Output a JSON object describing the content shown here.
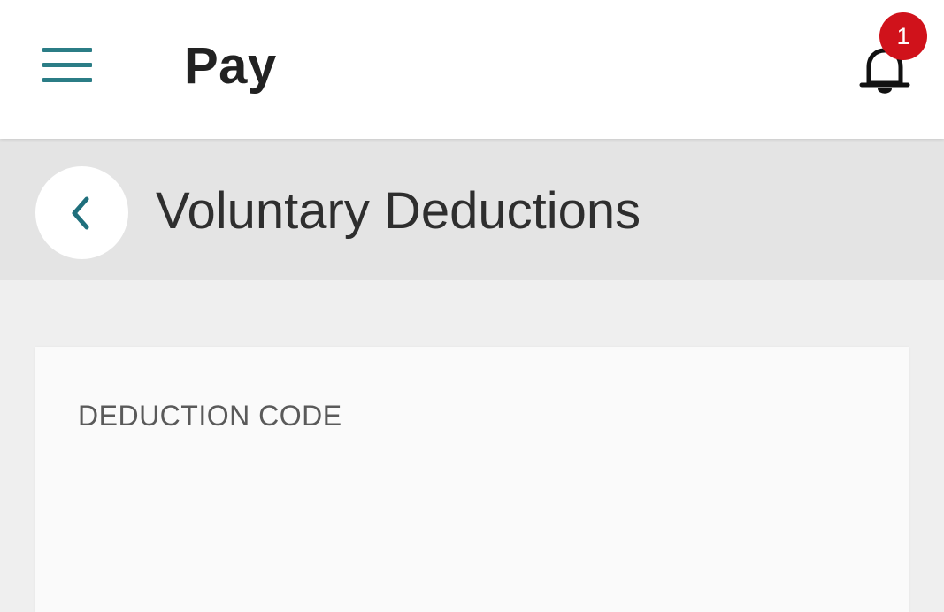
{
  "header": {
    "menu_icon": "hamburger-menu-icon",
    "title": "Pay",
    "notifications": {
      "icon": "bell-icon",
      "badge_count": "1",
      "badge_color": "#d0121b"
    }
  },
  "subheader": {
    "back_icon": "chevron-left-icon",
    "title": "Voluntary Deductions"
  },
  "card": {
    "deduction_code_label": "DEDUCTION CODE",
    "deduction_code_value": ""
  },
  "colors": {
    "accent": "#2b7d86",
    "header_bg": "#ffffff",
    "subheader_bg": "#e4e4e4",
    "page_bg": "#efefef"
  }
}
